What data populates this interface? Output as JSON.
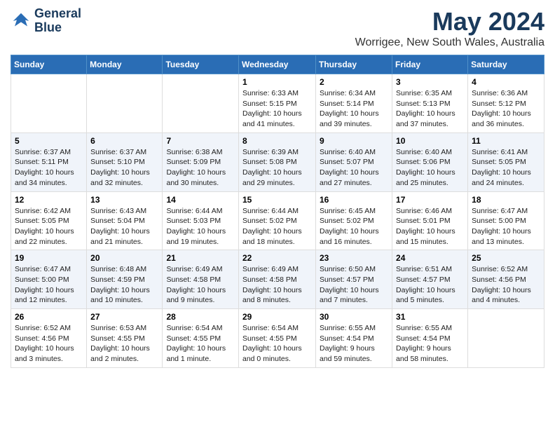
{
  "logo": {
    "line1": "General",
    "line2": "Blue"
  },
  "title": "May 2024",
  "subtitle": "Worrigee, New South Wales, Australia",
  "days_of_week": [
    "Sunday",
    "Monday",
    "Tuesday",
    "Wednesday",
    "Thursday",
    "Friday",
    "Saturday"
  ],
  "weeks": [
    [
      {
        "day": "",
        "info": ""
      },
      {
        "day": "",
        "info": ""
      },
      {
        "day": "",
        "info": ""
      },
      {
        "day": "1",
        "info": "Sunrise: 6:33 AM\nSunset: 5:15 PM\nDaylight: 10 hours\nand 41 minutes."
      },
      {
        "day": "2",
        "info": "Sunrise: 6:34 AM\nSunset: 5:14 PM\nDaylight: 10 hours\nand 39 minutes."
      },
      {
        "day": "3",
        "info": "Sunrise: 6:35 AM\nSunset: 5:13 PM\nDaylight: 10 hours\nand 37 minutes."
      },
      {
        "day": "4",
        "info": "Sunrise: 6:36 AM\nSunset: 5:12 PM\nDaylight: 10 hours\nand 36 minutes."
      }
    ],
    [
      {
        "day": "5",
        "info": "Sunrise: 6:37 AM\nSunset: 5:11 PM\nDaylight: 10 hours\nand 34 minutes."
      },
      {
        "day": "6",
        "info": "Sunrise: 6:37 AM\nSunset: 5:10 PM\nDaylight: 10 hours\nand 32 minutes."
      },
      {
        "day": "7",
        "info": "Sunrise: 6:38 AM\nSunset: 5:09 PM\nDaylight: 10 hours\nand 30 minutes."
      },
      {
        "day": "8",
        "info": "Sunrise: 6:39 AM\nSunset: 5:08 PM\nDaylight: 10 hours\nand 29 minutes."
      },
      {
        "day": "9",
        "info": "Sunrise: 6:40 AM\nSunset: 5:07 PM\nDaylight: 10 hours\nand 27 minutes."
      },
      {
        "day": "10",
        "info": "Sunrise: 6:40 AM\nSunset: 5:06 PM\nDaylight: 10 hours\nand 25 minutes."
      },
      {
        "day": "11",
        "info": "Sunrise: 6:41 AM\nSunset: 5:05 PM\nDaylight: 10 hours\nand 24 minutes."
      }
    ],
    [
      {
        "day": "12",
        "info": "Sunrise: 6:42 AM\nSunset: 5:05 PM\nDaylight: 10 hours\nand 22 minutes."
      },
      {
        "day": "13",
        "info": "Sunrise: 6:43 AM\nSunset: 5:04 PM\nDaylight: 10 hours\nand 21 minutes."
      },
      {
        "day": "14",
        "info": "Sunrise: 6:44 AM\nSunset: 5:03 PM\nDaylight: 10 hours\nand 19 minutes."
      },
      {
        "day": "15",
        "info": "Sunrise: 6:44 AM\nSunset: 5:02 PM\nDaylight: 10 hours\nand 18 minutes."
      },
      {
        "day": "16",
        "info": "Sunrise: 6:45 AM\nSunset: 5:02 PM\nDaylight: 10 hours\nand 16 minutes."
      },
      {
        "day": "17",
        "info": "Sunrise: 6:46 AM\nSunset: 5:01 PM\nDaylight: 10 hours\nand 15 minutes."
      },
      {
        "day": "18",
        "info": "Sunrise: 6:47 AM\nSunset: 5:00 PM\nDaylight: 10 hours\nand 13 minutes."
      }
    ],
    [
      {
        "day": "19",
        "info": "Sunrise: 6:47 AM\nSunset: 5:00 PM\nDaylight: 10 hours\nand 12 minutes."
      },
      {
        "day": "20",
        "info": "Sunrise: 6:48 AM\nSunset: 4:59 PM\nDaylight: 10 hours\nand 10 minutes."
      },
      {
        "day": "21",
        "info": "Sunrise: 6:49 AM\nSunset: 4:58 PM\nDaylight: 10 hours\nand 9 minutes."
      },
      {
        "day": "22",
        "info": "Sunrise: 6:49 AM\nSunset: 4:58 PM\nDaylight: 10 hours\nand 8 minutes."
      },
      {
        "day": "23",
        "info": "Sunrise: 6:50 AM\nSunset: 4:57 PM\nDaylight: 10 hours\nand 7 minutes."
      },
      {
        "day": "24",
        "info": "Sunrise: 6:51 AM\nSunset: 4:57 PM\nDaylight: 10 hours\nand 5 minutes."
      },
      {
        "day": "25",
        "info": "Sunrise: 6:52 AM\nSunset: 4:56 PM\nDaylight: 10 hours\nand 4 minutes."
      }
    ],
    [
      {
        "day": "26",
        "info": "Sunrise: 6:52 AM\nSunset: 4:56 PM\nDaylight: 10 hours\nand 3 minutes."
      },
      {
        "day": "27",
        "info": "Sunrise: 6:53 AM\nSunset: 4:55 PM\nDaylight: 10 hours\nand 2 minutes."
      },
      {
        "day": "28",
        "info": "Sunrise: 6:54 AM\nSunset: 4:55 PM\nDaylight: 10 hours\nand 1 minute."
      },
      {
        "day": "29",
        "info": "Sunrise: 6:54 AM\nSunset: 4:55 PM\nDaylight: 10 hours\nand 0 minutes."
      },
      {
        "day": "30",
        "info": "Sunrise: 6:55 AM\nSunset: 4:54 PM\nDaylight: 9 hours\nand 59 minutes."
      },
      {
        "day": "31",
        "info": "Sunrise: 6:55 AM\nSunset: 4:54 PM\nDaylight: 9 hours\nand 58 minutes."
      },
      {
        "day": "",
        "info": ""
      }
    ]
  ]
}
